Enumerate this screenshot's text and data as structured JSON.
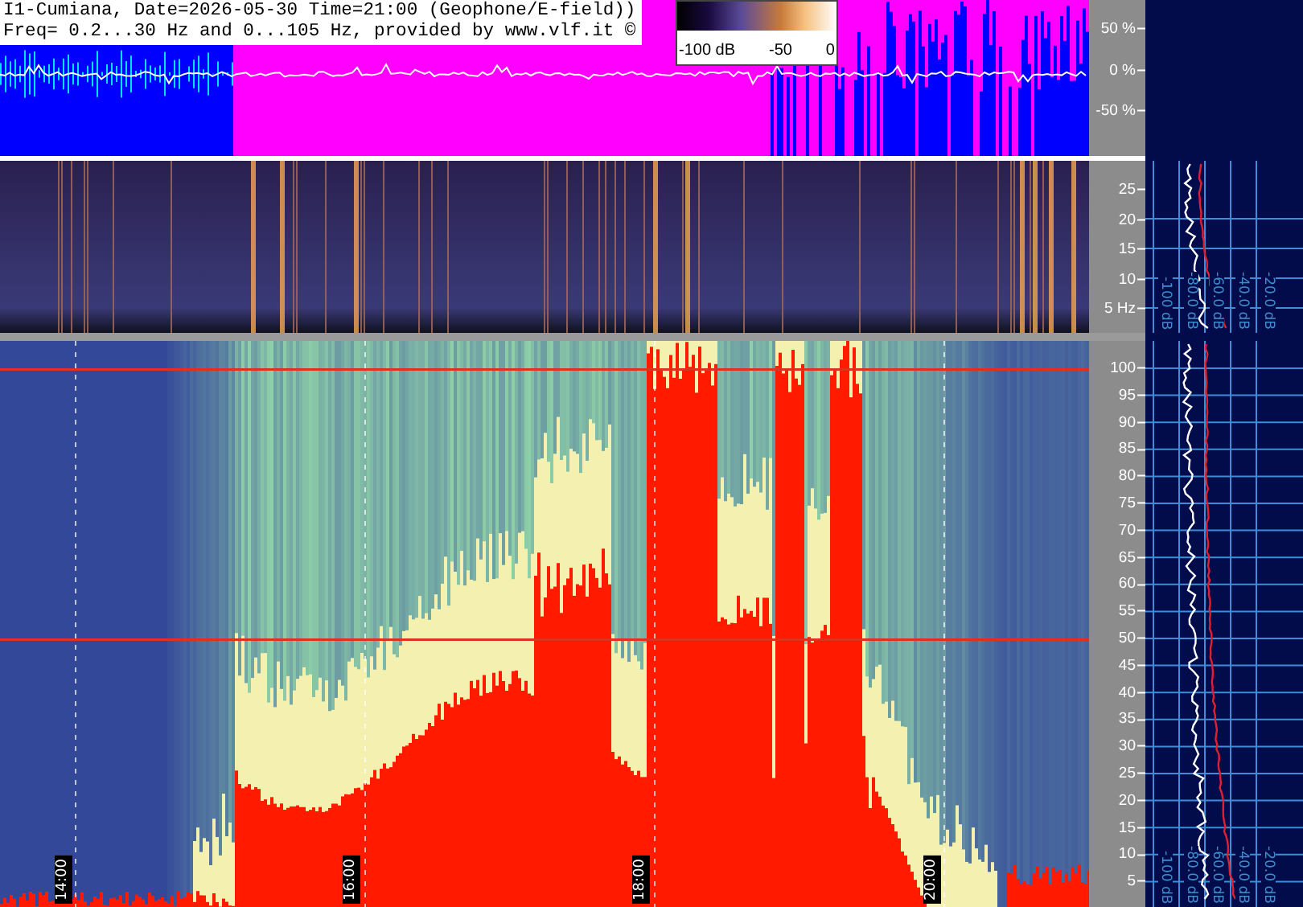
{
  "header": {
    "title_line": "I1-Cumiana, Date=2026-05-30 Time=21:00 (Geophone/E-field))",
    "freq_line": "Freq= 0.2...30 Hz and 0...105 Hz, provided by www.vlf.it ©"
  },
  "colorbar": {
    "labels": [
      "-100 dB",
      "-50",
      "0"
    ]
  },
  "waveform_axis": {
    "labels": [
      "50 %",
      "0 %",
      "-50 %"
    ]
  },
  "low_freq_axis": {
    "labels": [
      "25",
      "20",
      "15",
      "10",
      "5 Hz"
    ]
  },
  "high_freq_axis": {
    "labels": [
      "100",
      "95",
      "90",
      "85",
      "80",
      "75",
      "70",
      "65",
      "60",
      "55",
      "50",
      "45",
      "40",
      "35",
      "30",
      "25",
      "20",
      "15",
      "10",
      "5"
    ]
  },
  "time_labels": [
    "14:00",
    "16:00",
    "18:00",
    "20:00"
  ],
  "low_spectrum": {
    "db_labels": [
      "-100 dB",
      "-80.0 dB",
      "-60.0 dB",
      "-40.0 dB",
      "-20.0 dB"
    ]
  },
  "high_spectrum": {
    "db_labels": [
      "-100 dB",
      "-80.0 dB",
      "-60.0 dB",
      "-40.0 dB",
      "-20.0 dB"
    ]
  }
}
